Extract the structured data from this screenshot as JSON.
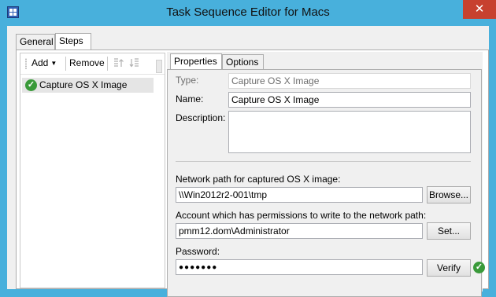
{
  "window": {
    "title": "Task Sequence Editor for Macs",
    "close_glyph": "✕"
  },
  "tabs": [
    {
      "label": "General"
    },
    {
      "label": "Steps"
    }
  ],
  "toolbar": {
    "add_label": "Add",
    "add_caret": "▼",
    "remove_label": "Remove"
  },
  "steps": [
    {
      "label": "Capture OS X Image",
      "status": "success"
    }
  ],
  "inner_tabs": [
    {
      "label": "Properties"
    },
    {
      "label": "Options"
    }
  ],
  "properties": {
    "type_label": "Type:",
    "type_value": "Capture OS X Image",
    "name_label": "Name:",
    "name_value": "Capture OS X Image",
    "description_label": "Description:",
    "description_value": "",
    "network_path_label": "Network path for captured OS X image:",
    "network_path_value": "\\\\Win2012r2-001\\tmp",
    "browse_label": "Browse...",
    "account_label": "Account which has permissions to write to the network path:",
    "account_value": "pmm12.dom\\Administrator",
    "set_label": "Set...",
    "password_label": "Password:",
    "password_value": "●●●●●●●",
    "verify_label": "Verify"
  },
  "colors": {
    "title_bar": "#48b0dc",
    "close_button": "#c7412f",
    "success": "#3a9a3a",
    "selection": "#e5e5e5"
  }
}
